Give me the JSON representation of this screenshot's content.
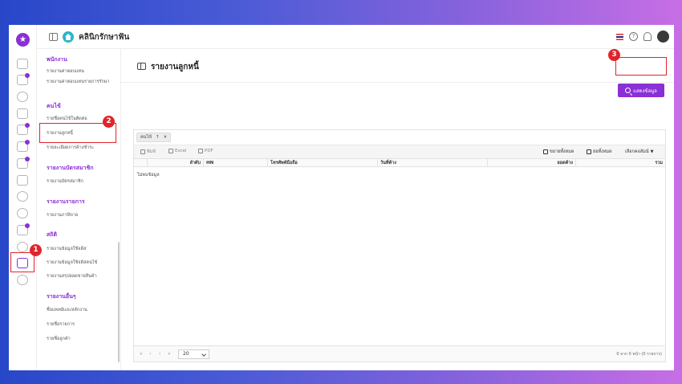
{
  "header": {
    "clinic_name": "คลินิกรักษาฟัน",
    "help_glyph": "?"
  },
  "rail": {
    "logo_glyph": "★",
    "icons": [
      "home-icon",
      "appointment-icon",
      "patient-icon",
      "pos-icon",
      "inventory-icon",
      "calendar-icon",
      "finance-icon",
      "cart-icon",
      "discount-icon",
      "cloud-icon",
      "message-icon",
      "info-icon",
      "report-icon",
      "settings-icon"
    ]
  },
  "submenu": {
    "sections": [
      {
        "heading": "พนักงาน",
        "items": [
          "รายงานค่าตอบแทน",
          "รายงานค่าตอบแทนรายการรักษา"
        ]
      },
      {
        "heading": "คนไข้",
        "items": [
          "รายชื่อคนไข้ในติดต่อ",
          "รายงานลูกหนี้",
          "รายละเอียดการค้างชำระ"
        ]
      },
      {
        "heading": "รายงานบัตรสมาชิก",
        "items": [
          "รายงานบัตรสมาชิก"
        ]
      },
      {
        "heading": "รายงานรายการ",
        "items": [
          "รายงานภาษีขาย"
        ]
      },
      {
        "heading": "สถิติ",
        "items": [
          "รายงานข้อมูลใช้จดิส",
          "รายงานข้อมูลใช้จดิสคนไข้",
          "รายงานสรุปยอดขายสินค้า"
        ]
      },
      {
        "heading": "รายงานอื่นๆ",
        "items": [
          "ชื่อแพทย์และหลักงาน",
          "รายชื่อรายการ",
          "รายชื่อลูกค้า"
        ]
      }
    ]
  },
  "page": {
    "title": "รายงานลูกหนี้",
    "show_button": "แสดงข้อมูล"
  },
  "grid": {
    "group_chip": {
      "label": "คนไข้",
      "sort": "↑",
      "remove": "✕"
    },
    "toolbar": {
      "print": "พิมพ์",
      "excel": "Excel",
      "pdf": "PDF",
      "expand_all": "ขยายทั้งหมด",
      "collapse_all": "ย่อทั้งหมด",
      "choose_columns": "เลือกคอลัมน์"
    },
    "columns": [
      "ลำดับ",
      "HN",
      "โทรศัพท์มือถือ",
      "วันที่ค้าง",
      "ยอดค้าง",
      "รวม"
    ],
    "empty": "ไม่พบข้อมูล",
    "pager": {
      "first": "«",
      "prev": "‹",
      "next": "›",
      "last": "»",
      "page_size": "20",
      "info": "0 จาก 0 หน้า (0 รายการ)"
    }
  },
  "annotations": {
    "step1": "1",
    "step2": "2",
    "step3": "3",
    "color": "#e1242b"
  },
  "colors": {
    "accent": "#8b2fd6",
    "highlight": "#e1242b"
  }
}
